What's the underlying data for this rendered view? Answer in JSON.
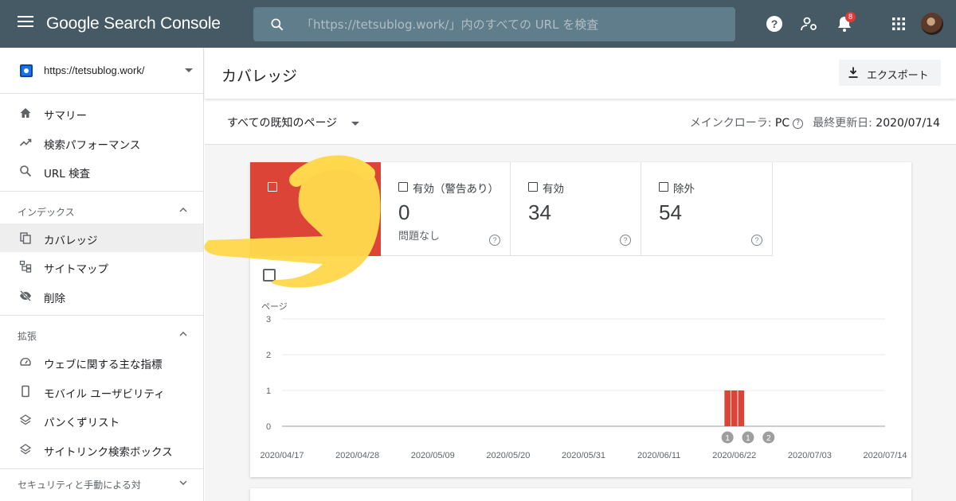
{
  "topbar": {
    "brand": "Google Search Console",
    "search_placeholder": "「https://tetsublog.work/」内のすべての URL を検査",
    "notification_count": "8"
  },
  "sidebar": {
    "property": "https://tetsublog.work/",
    "primary": [
      {
        "label": "サマリー",
        "icon": "home-icon"
      },
      {
        "label": "検索パフォーマンス",
        "icon": "trending-icon"
      },
      {
        "label": "URL 検査",
        "icon": "search-icon"
      }
    ],
    "index_section": "インデックス",
    "index_items": [
      {
        "label": "カバレッジ",
        "icon": "copy-icon"
      },
      {
        "label": "サイトマップ",
        "icon": "sitemap-icon"
      },
      {
        "label": "削除",
        "icon": "eye-off-icon"
      }
    ],
    "enhancements_section": "拡張",
    "enhancement_items": [
      {
        "label": "ウェブに関する主な指標",
        "icon": "speed-icon"
      },
      {
        "label": "モバイル ユーザビリティ",
        "icon": "phone-icon"
      },
      {
        "label": "パンくずリスト",
        "icon": "layers-icon"
      },
      {
        "label": "サイトリンク検索ボックス",
        "icon": "layers-icon"
      }
    ],
    "security_section": "セキュリティと手動による対"
  },
  "main": {
    "title": "カバレッジ",
    "export_label": "エクスポート",
    "filter_value": "すべての既知のページ",
    "crawler_label": "メインクローラ:",
    "crawler_value": "PC",
    "updated_label": "最終更新日:",
    "updated_value": "2020/07/14"
  },
  "tiles": [
    {
      "label": "",
      "value": "",
      "sub": "",
      "status": "error",
      "color": "#db4437"
    },
    {
      "label": "有効（警告あり）",
      "value": "0",
      "sub": "問題なし"
    },
    {
      "label": "有効",
      "value": "34",
      "sub": ""
    },
    {
      "label": "除外",
      "value": "54",
      "sub": ""
    }
  ],
  "chart_data": {
    "type": "bar",
    "ylabel": "ページ",
    "ylim": [
      0,
      3
    ],
    "yticks": [
      0,
      1,
      2,
      3
    ],
    "xticks": [
      "2020/04/17",
      "2020/04/28",
      "2020/05/09",
      "2020/05/20",
      "2020/05/31",
      "2020/06/11",
      "2020/06/22",
      "2020/07/03",
      "2020/07/14"
    ],
    "series": [
      {
        "color": "#db4437",
        "points": [
          {
            "x": "2020/06/21",
            "y": 1
          },
          {
            "x": "2020/06/22",
            "y": 1
          },
          {
            "x": "2020/06/23",
            "y": 1
          }
        ]
      }
    ],
    "annotations": [
      {
        "x": "2020/06/21",
        "label": "1"
      },
      {
        "x": "2020/06/24",
        "label": "1"
      },
      {
        "x": "2020/06/27",
        "label": "2"
      }
    ]
  }
}
